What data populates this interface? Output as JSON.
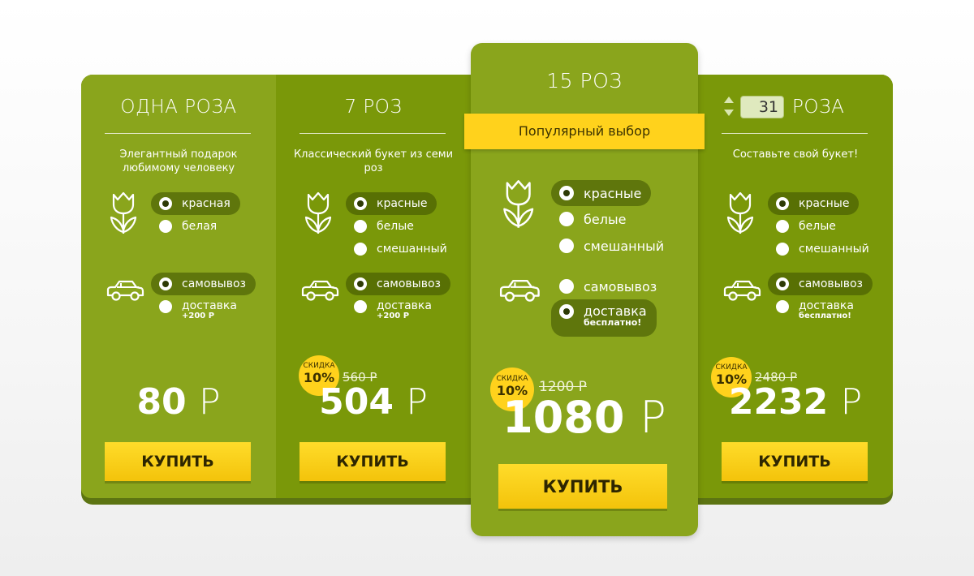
{
  "colors": {
    "accent_yellow": "#ffd21c",
    "green_light": "#8aa51c",
    "green_dark": "#7a9809"
  },
  "plans": [
    {
      "title": "ОДНА РОЗА",
      "description": "Элегантный подарок любимому человеку",
      "flower_options": [
        {
          "label": "красная",
          "selected": true
        },
        {
          "label": "белая",
          "selected": false
        }
      ],
      "delivery_options": [
        {
          "label": "самовывоз",
          "note": "",
          "selected": true
        },
        {
          "label": "доставка",
          "note": "+200 Р",
          "selected": false
        }
      ],
      "price": "80",
      "currency": "Р",
      "buy_label": "КУПИТЬ"
    },
    {
      "title": "7 РОЗ",
      "description": "Классический букет из семи роз",
      "flower_options": [
        {
          "label": "красные",
          "selected": true
        },
        {
          "label": "белые",
          "selected": false
        },
        {
          "label": "смешанный",
          "selected": false
        }
      ],
      "delivery_options": [
        {
          "label": "самовывоз",
          "note": "",
          "selected": true
        },
        {
          "label": "доставка",
          "note": "+200 Р",
          "selected": false
        }
      ],
      "discount_badge": {
        "label": "СКИДКА",
        "value": "10%"
      },
      "old_price": "560 Р",
      "price": "504",
      "currency": "Р",
      "buy_label": "КУПИТЬ"
    },
    {
      "title": "15 РОЗ",
      "ribbon": "Популярный выбор",
      "flower_options": [
        {
          "label": "красные",
          "selected": true
        },
        {
          "label": "белые",
          "selected": false
        },
        {
          "label": "смешанный",
          "selected": false
        }
      ],
      "delivery_options": [
        {
          "label": "самовывоз",
          "note": "",
          "selected": false
        },
        {
          "label": "доставка",
          "note": "бесплатно!",
          "selected": true
        }
      ],
      "discount_badge": {
        "label": "СКИДКА",
        "value": "10%"
      },
      "old_price": "1200 Р",
      "price": "1080",
      "currency": "Р",
      "buy_label": "КУПИТЬ"
    },
    {
      "quantity": "31",
      "title": "РОЗА",
      "description": "Составьте свой букет!",
      "flower_options": [
        {
          "label": "красные",
          "selected": true
        },
        {
          "label": "белые",
          "selected": false
        },
        {
          "label": "смешанный",
          "selected": false
        }
      ],
      "delivery_options": [
        {
          "label": "самовывоз",
          "note": "",
          "selected": true
        },
        {
          "label": "доставка",
          "note": "бесплатно!",
          "selected": false
        }
      ],
      "discount_badge": {
        "label": "СКИДКА",
        "value": "10%"
      },
      "old_price": "2480 Р",
      "price": "2232",
      "currency": "Р",
      "buy_label": "КУПИТЬ"
    }
  ]
}
